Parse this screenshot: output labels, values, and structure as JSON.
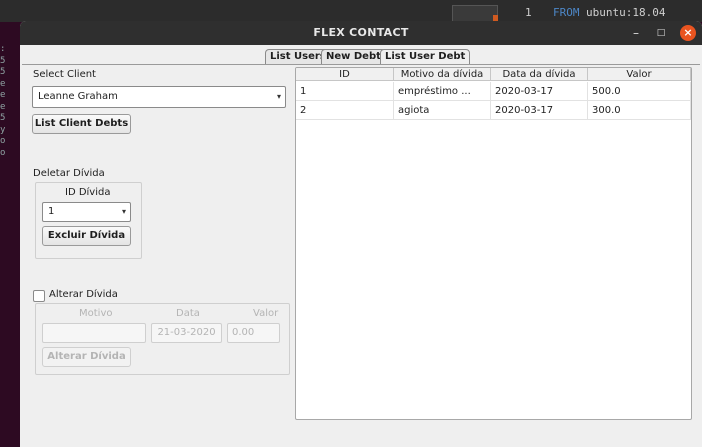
{
  "window": {
    "title": "FLEX CONTACT"
  },
  "background": {
    "terminal_text_line_num": "1",
    "terminal_text_from": "FROM",
    "terminal_text_image": "ubuntu:18.04"
  },
  "tabs": [
    {
      "label": "List Users"
    },
    {
      "label": "New Debt"
    },
    {
      "label": "List User Debt",
      "active": true
    }
  ],
  "select_client": {
    "label": "Select Client",
    "value": "Leanne Graham",
    "button": "List Client Debts"
  },
  "delete_debt": {
    "label": "Deletar Dívida",
    "id_label": "ID Dívida",
    "id_value": "1",
    "button": "Excluir Dívida"
  },
  "alter_debt": {
    "checkbox_label": "Alterar Dívida",
    "motivo_label": "Motivo",
    "data_label": "Data",
    "valor_label": "Valor",
    "motivo_value": "",
    "data_value": "21-03-2020",
    "valor_value": "0.00",
    "button": "Alterar Dívida"
  },
  "table": {
    "columns": [
      "ID",
      "Motivo da dívida",
      "Data da dívida",
      "Valor"
    ],
    "rows": [
      [
        "1",
        "empréstimo ...",
        "2020-03-17",
        "500.0"
      ],
      [
        "2",
        "agiota",
        "2020-03-17",
        "300.0"
      ]
    ]
  },
  "colors": {
    "titlebar": "#2f2f2f",
    "close_button": "#e95420",
    "window_bg": "#efefef"
  }
}
